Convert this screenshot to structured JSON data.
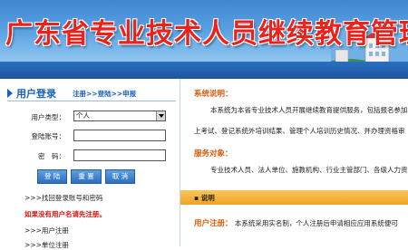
{
  "banner": {
    "title": "广东省专业技术人员继续教育管理系统"
  },
  "login": {
    "title": "用户登录",
    "links": [
      "注册",
      "登陆",
      "申报"
    ],
    "links_sep": ">>",
    "user_type_label": "用户类型：",
    "user_type_value": "个人",
    "account_label": "登陆账号：",
    "password_label": "密　码：",
    "buttons": {
      "login": "登 陆",
      "reset": "重 置",
      "cancel": "取 消"
    },
    "recover": ">>>找回登录账号和密码",
    "red_note": "如果没有用户名请先注册。",
    "personal_reg": ">>>用户注册",
    "unit_reg": ">>>单位注册"
  },
  "system_desc": {
    "title": "系统说明：",
    "line1": "本系统为本省专业技术人员开展继续教育提供服务，包括报名参加",
    "line2": "上考试、登记系统外培训结果、管理个人培训历史情况、并办理资格审"
  },
  "service": {
    "title": "服务对象：",
    "line1": "专业技术人员、法人单位、施教机构、行业主管部门、各级人力资"
  },
  "notice_bar": {
    "label": "▪ 说明"
  },
  "registration": {
    "head": "用户注册：",
    "text": "本系统采用实名制，个人注册后申请相应应用系统便可"
  }
}
